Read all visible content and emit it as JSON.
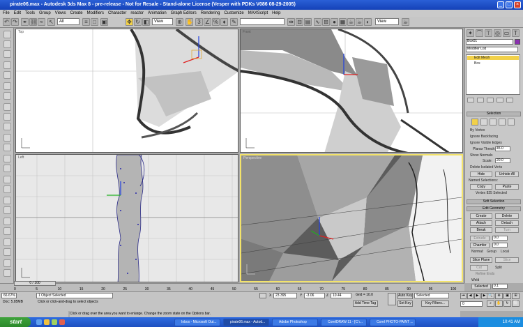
{
  "window": {
    "title": "pirate06.max - Autodesk 3ds Max 8 - pre-release - Not for Resale - Stand-alone License (Vesper with PDKs V086 08-29-2005)"
  },
  "menu": [
    "File",
    "Edit",
    "Tools",
    "Group",
    "Views",
    "Create",
    "Modifiers",
    "Character",
    "reactor",
    "Animation",
    "Graph Editors",
    "Rendering",
    "Customize",
    "MAXScript",
    "Help"
  ],
  "toolbar": {
    "selection_filter": "All",
    "reference_coord": "View",
    "named_selection": "",
    "view_right": "View"
  },
  "viewports": {
    "top_left": "Top",
    "top_right": "Front",
    "bottom_left": "Left",
    "bottom_right": "Perspective"
  },
  "command_panel": {
    "object_name": "Box01",
    "modifier_list": "Modifier List",
    "stack": [
      "Edit Mesh",
      "Box"
    ],
    "selection_header": "Selection",
    "by_vertex": "By Vertex",
    "ignore_backfacing": "Ignore Backfacing",
    "ignore_visible_edges": "Ignore Visible Edges",
    "planar_thresh_label": "Planar Thresh:",
    "planar_thresh_value": "45.0",
    "show_normals": "Show Normals",
    "scale_label": "Scale:",
    "scale_value": "20.0",
    "delete_isolated": "Delete Isolated Verts",
    "hide": "Hide",
    "unhide_all": "Unhide All",
    "named_selections": "Named Selections:",
    "copy": "Copy",
    "paste": "Paste",
    "vertices_selected": "Vertex 825 Selected",
    "soft_selection": "Soft Selection",
    "edit_geometry": "Edit Geometry",
    "create": "Create",
    "delete": "Delete",
    "attach": "Attach",
    "detach": "Detach",
    "break": "Break",
    "turn": "Turn",
    "extrude": "Extrude",
    "extrude_value": "0.0",
    "chamfer": "Chamfer",
    "chamfer_value": "0.0",
    "normal": "Normal:",
    "group": "Group",
    "local": "Local",
    "slice_plane": "Slice Plane",
    "slice": "Slice",
    "cut": "Cut",
    "split": "Split",
    "refine_ends": "Refine Ends",
    "weld": "Weld",
    "selected": "Selected",
    "weld_value": "0.1"
  },
  "timeline": {
    "frame": "0 / 100",
    "ticks": [
      "0",
      "5",
      "10",
      "15",
      "20",
      "25",
      "30",
      "35",
      "40",
      "45",
      "50",
      "55",
      "60",
      "65",
      "70",
      "75",
      "80",
      "85",
      "90",
      "95",
      "100"
    ]
  },
  "status": {
    "listener": "66.67%",
    "docs": "Doc: 5.85MB",
    "objects_selected": "1 Object Selected",
    "prompt": "Click or click-and-drag to select objects",
    "hint": "Click or drag over the area you want to enlarge. Change the zoom state on the Options bar.",
    "x": "23.395",
    "y": "-3.06",
    "z": "10.44",
    "grid": "Grid = 10.0",
    "add_time_tag": "Add Time Tag",
    "auto_key": "Auto Key",
    "set_key": "Set Key",
    "key_mode": "Selected",
    "key_filters": "Key Filters...",
    "frame_value": "0"
  },
  "taskbar": {
    "start": "start",
    "tasks": [
      "Inbox - Microsoft Out...",
      "pirate06.max - Autod...",
      "Adobe Photoshop",
      "CorelDRAW 11 - [C:\\...",
      "Corel PHOTO-PAINT ..."
    ],
    "time": "10:41 AM"
  },
  "colors": {
    "title_blue": "#1542b8",
    "taskbar_blue": "#2f6ce0",
    "viewport_active_border": "#f3e36a",
    "axis_x": "#e02020",
    "axis_y": "#20b020",
    "axis_z": "#2040e0"
  }
}
